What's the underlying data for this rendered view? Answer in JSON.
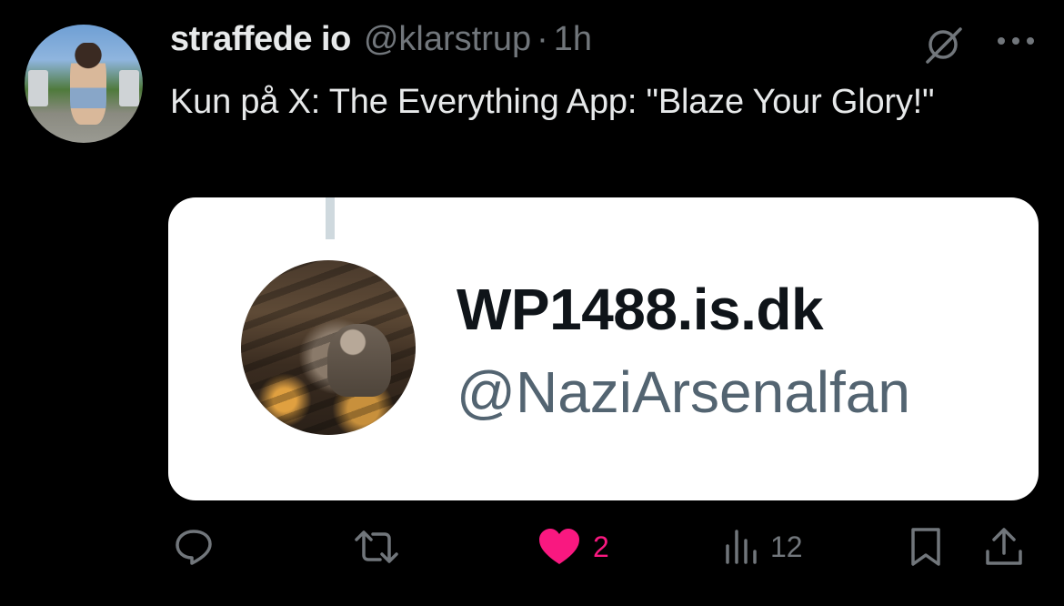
{
  "post": {
    "display_name": "straffede io",
    "handle": "@klarstrup",
    "separator": "·",
    "time": "1h",
    "text": "Kun på X: The Everything App: \"Blaze Your Glory!\""
  },
  "embedded_card": {
    "name": "WP1488.is.dk",
    "handle": "@NaziArsenalfan"
  },
  "actions": {
    "reply_icon": "reply-icon",
    "repost_icon": "repost-icon",
    "like_icon": "heart-filled-icon",
    "like_count": "2",
    "views_icon": "views-icon",
    "views_count": "12",
    "bookmark_icon": "bookmark-icon",
    "share_icon": "share-icon"
  },
  "colors": {
    "background": "#000000",
    "primary_text": "#e7e9ea",
    "secondary_text": "#71767b",
    "like_pink": "#f91880",
    "card_background": "#ffffff"
  }
}
